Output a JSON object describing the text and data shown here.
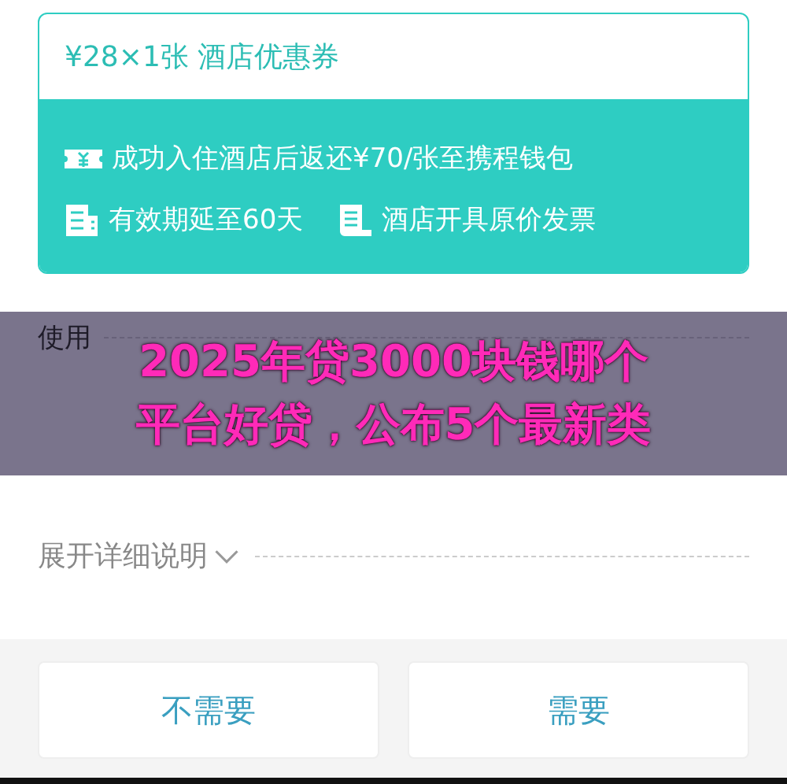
{
  "coupon": {
    "title": "¥28×1张 酒店优惠券",
    "benefits": [
      {
        "kind": "cashback",
        "text": "成功入住酒店后返还¥70/张至携程钱包"
      },
      {
        "kind": "validity",
        "text": "有效期延至60天"
      },
      {
        "kind": "invoice",
        "text": "酒店开具原价发票"
      }
    ]
  },
  "tips": {
    "title": "使用"
  },
  "banner": {
    "lines": [
      "2025年贷3000块钱哪个",
      "平台好贷，公布5个最新类"
    ]
  },
  "expand": {
    "label": "展开详细说明"
  },
  "buttons": [
    "不需要",
    "需要"
  ]
}
